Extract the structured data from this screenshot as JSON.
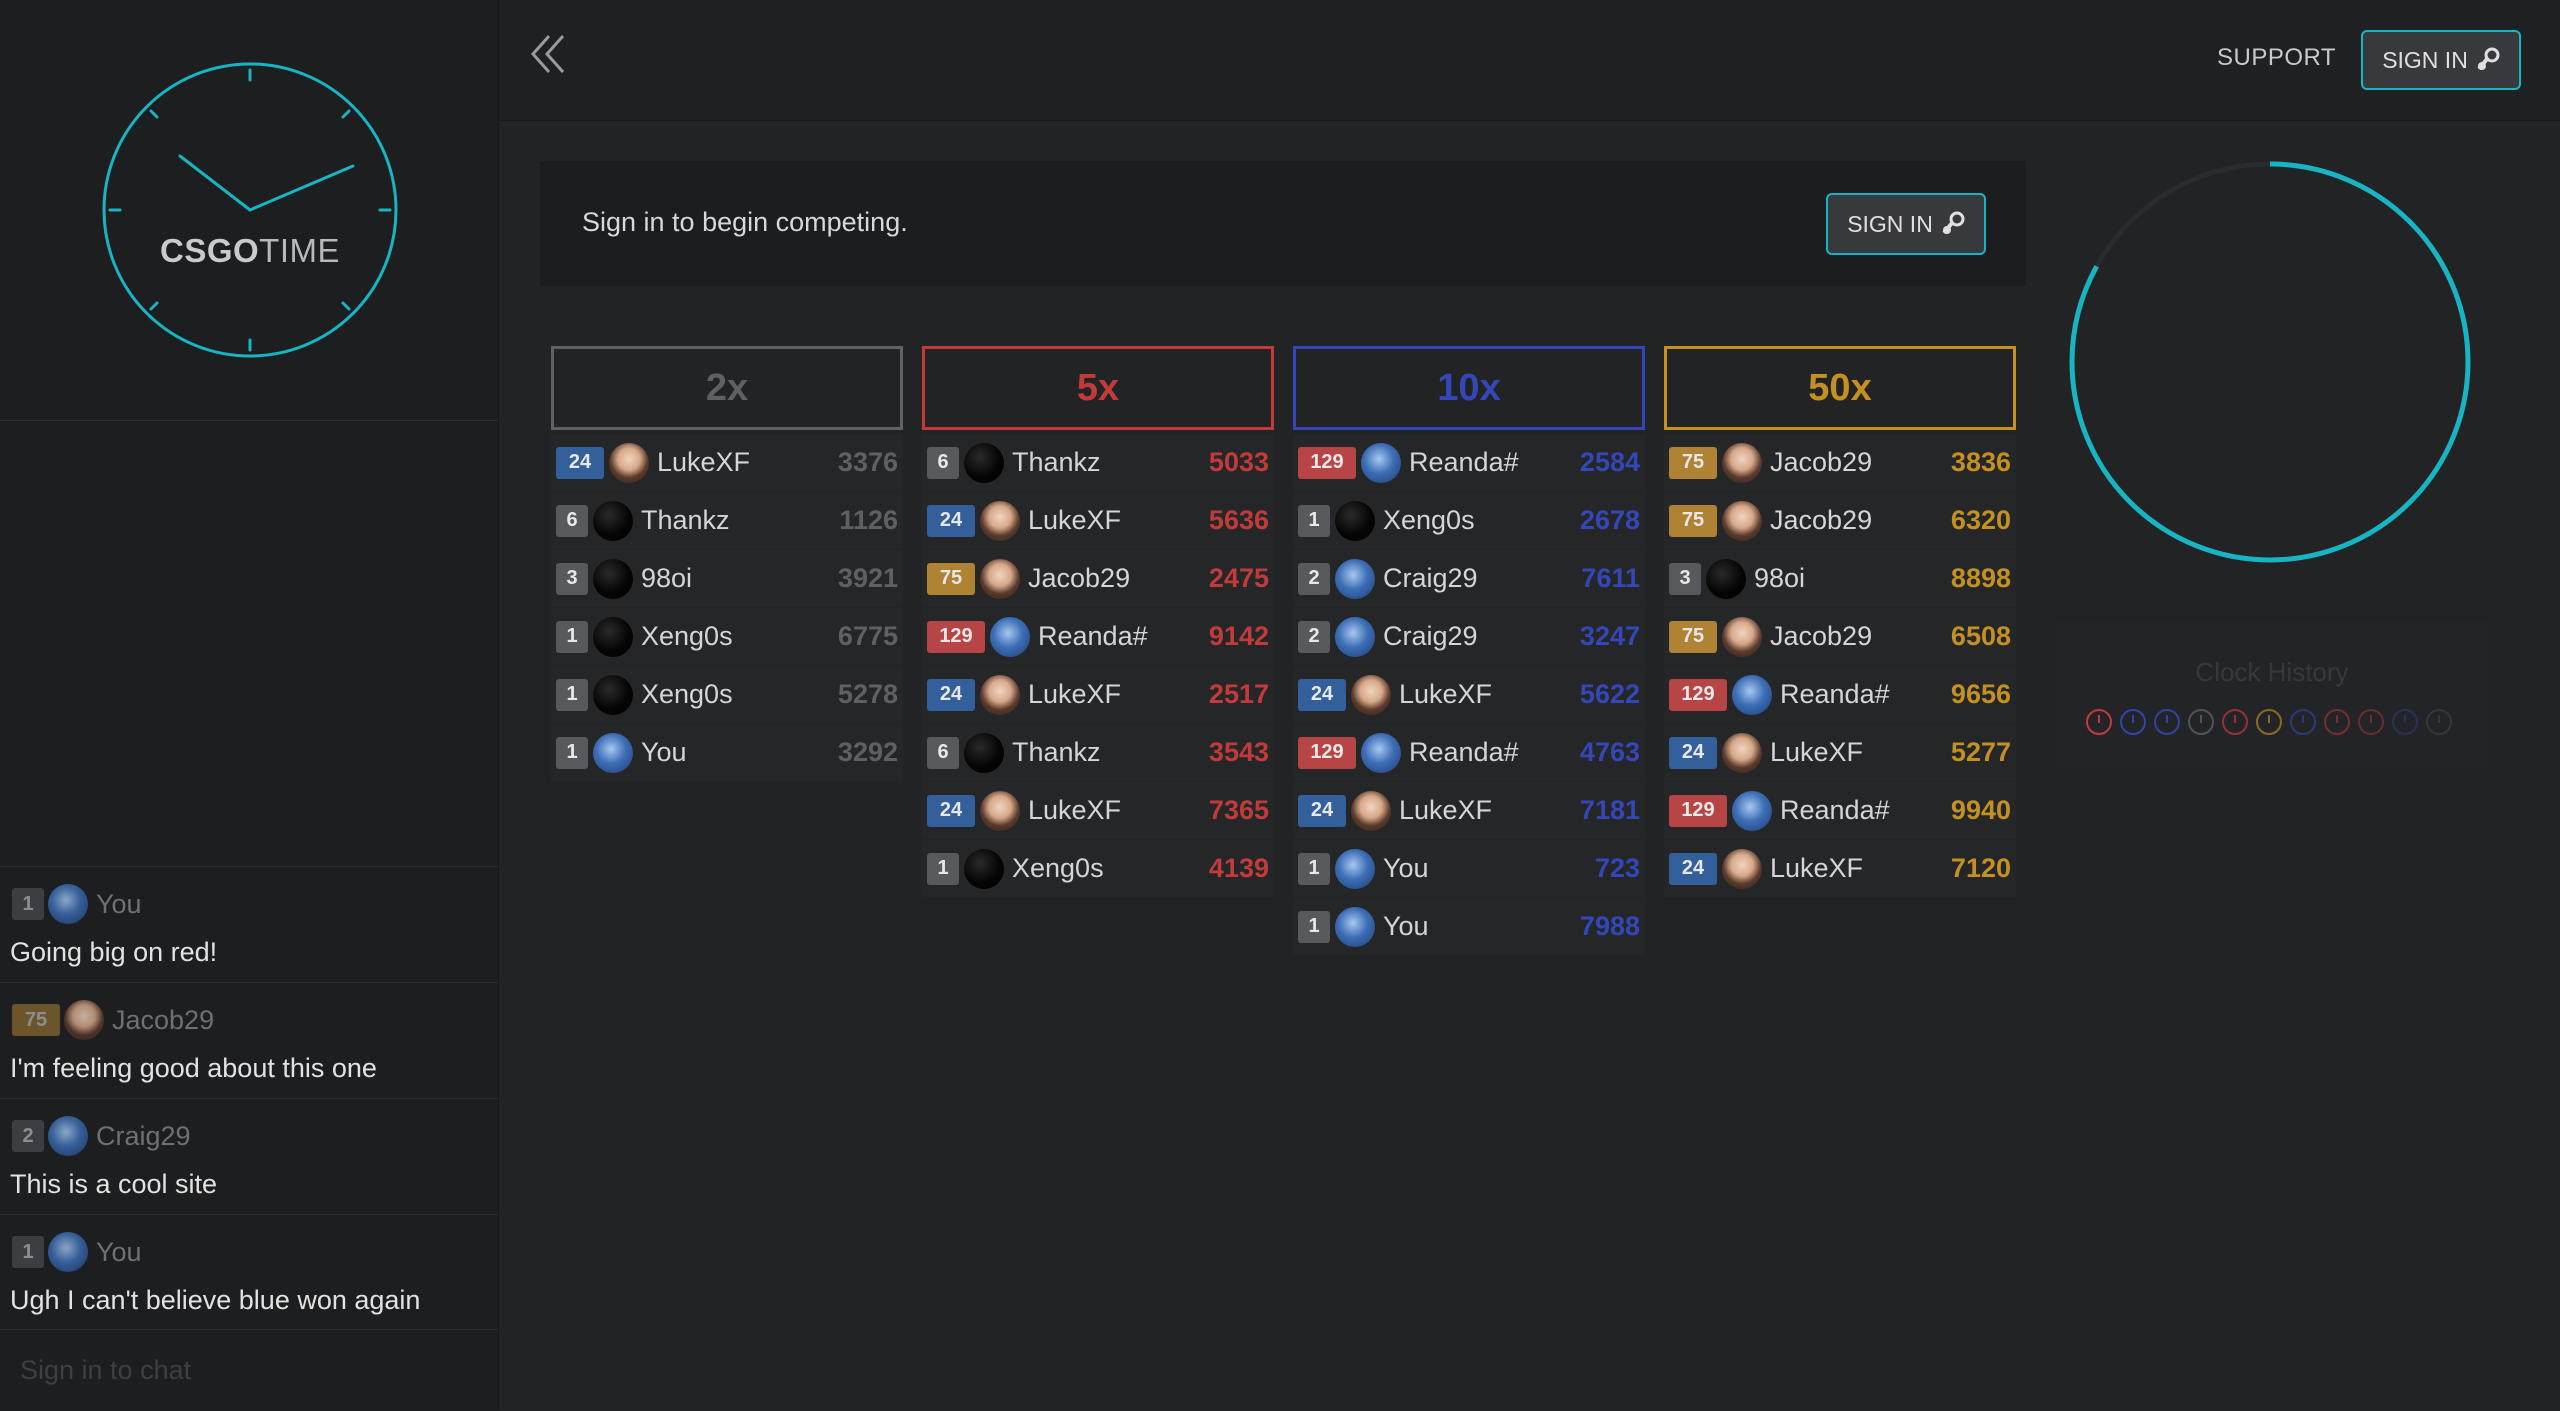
{
  "app": {
    "logo_bold": "CSGO",
    "logo_light": "TIME"
  },
  "header": {
    "support_label": "SUPPORT",
    "signin_label": "SIGN IN"
  },
  "banner": {
    "text": "Sign in to begin competing.",
    "signin_label": "SIGN IN"
  },
  "colors": {
    "accent": "#17b5c4",
    "gray": "#5f6063",
    "red": "#c23a3a",
    "blue": "#3447b8",
    "gold": "#c39021"
  },
  "columns": [
    {
      "label": "2x",
      "color": "#5f6063",
      "bets": [
        {
          "level": "24",
          "avatar": "anime",
          "name": "LukeXF",
          "amount": "3376"
        },
        {
          "level": "6",
          "avatar": "dark",
          "name": "Thankz",
          "amount": "1126"
        },
        {
          "level": "3",
          "avatar": "dark",
          "name": "98oi",
          "amount": "3921"
        },
        {
          "level": "1",
          "avatar": "dark",
          "name": "Xeng0s",
          "amount": "6775"
        },
        {
          "level": "1",
          "avatar": "dark",
          "name": "Xeng0s",
          "amount": "5278"
        },
        {
          "level": "1",
          "avatar": "blue",
          "name": "You",
          "amount": "3292"
        }
      ]
    },
    {
      "label": "5x",
      "color": "#c23a3a",
      "bets": [
        {
          "level": "6",
          "avatar": "dark",
          "name": "Thankz",
          "amount": "5033"
        },
        {
          "level": "24",
          "avatar": "anime",
          "name": "LukeXF",
          "amount": "5636"
        },
        {
          "level": "75",
          "avatar": "anime",
          "name": "Jacob29",
          "amount": "2475"
        },
        {
          "level": "129",
          "avatar": "blue",
          "name": "Reanda#",
          "amount": "9142"
        },
        {
          "level": "24",
          "avatar": "anime",
          "name": "LukeXF",
          "amount": "2517"
        },
        {
          "level": "6",
          "avatar": "dark",
          "name": "Thankz",
          "amount": "3543"
        },
        {
          "level": "24",
          "avatar": "anime",
          "name": "LukeXF",
          "amount": "7365"
        },
        {
          "level": "1",
          "avatar": "dark",
          "name": "Xeng0s",
          "amount": "4139"
        }
      ]
    },
    {
      "label": "10x",
      "color": "#3447b8",
      "bets": [
        {
          "level": "129",
          "avatar": "blue",
          "name": "Reanda#",
          "amount": "2584"
        },
        {
          "level": "1",
          "avatar": "dark",
          "name": "Xeng0s",
          "amount": "2678"
        },
        {
          "level": "2",
          "avatar": "blue",
          "name": "Craig29",
          "amount": "7611"
        },
        {
          "level": "2",
          "avatar": "blue",
          "name": "Craig29",
          "amount": "3247"
        },
        {
          "level": "24",
          "avatar": "anime",
          "name": "LukeXF",
          "amount": "5622"
        },
        {
          "level": "129",
          "avatar": "blue",
          "name": "Reanda#",
          "amount": "4763"
        },
        {
          "level": "24",
          "avatar": "anime",
          "name": "LukeXF",
          "amount": "7181"
        },
        {
          "level": "1",
          "avatar": "blue",
          "name": "You",
          "amount": "723"
        },
        {
          "level": "1",
          "avatar": "blue",
          "name": "You",
          "amount": "7988"
        }
      ]
    },
    {
      "label": "50x",
      "color": "#c39021",
      "bets": [
        {
          "level": "75",
          "avatar": "anime",
          "name": "Jacob29",
          "amount": "3836"
        },
        {
          "level": "75",
          "avatar": "anime",
          "name": "Jacob29",
          "amount": "6320"
        },
        {
          "level": "3",
          "avatar": "dark",
          "name": "98oi",
          "amount": "8898"
        },
        {
          "level": "75",
          "avatar": "anime",
          "name": "Jacob29",
          "amount": "6508"
        },
        {
          "level": "129",
          "avatar": "blue",
          "name": "Reanda#",
          "amount": "9656"
        },
        {
          "level": "24",
          "avatar": "anime",
          "name": "LukeXF",
          "amount": "5277"
        },
        {
          "level": "129",
          "avatar": "blue",
          "name": "Reanda#",
          "amount": "9940"
        },
        {
          "level": "24",
          "avatar": "anime",
          "name": "LukeXF",
          "amount": "7120"
        }
      ]
    }
  ],
  "timer": {
    "progress": 0.83
  },
  "history": {
    "title": "Clock History",
    "results": [
      "#c23a3a",
      "#3447b8",
      "#3447b8",
      "#5f6063",
      "#c23a3a",
      "#c39021",
      "#3447b8",
      "#c23a3a",
      "#c23a3a",
      "#3447b8",
      "#5f6063"
    ]
  },
  "chat": {
    "messages": [
      {
        "level": "1",
        "avatar": "blue",
        "user": "You",
        "text": "Going big on red!"
      },
      {
        "level": "75",
        "avatar": "anime",
        "user": "Jacob29",
        "text": "I'm feeling good about this one"
      },
      {
        "level": "2",
        "avatar": "blue",
        "user": "Craig29",
        "text": "This is a cool site"
      },
      {
        "level": "1",
        "avatar": "blue",
        "user": "You",
        "text": "Ugh I can't believe blue won again"
      }
    ],
    "input_placeholder": "Sign in to chat"
  }
}
